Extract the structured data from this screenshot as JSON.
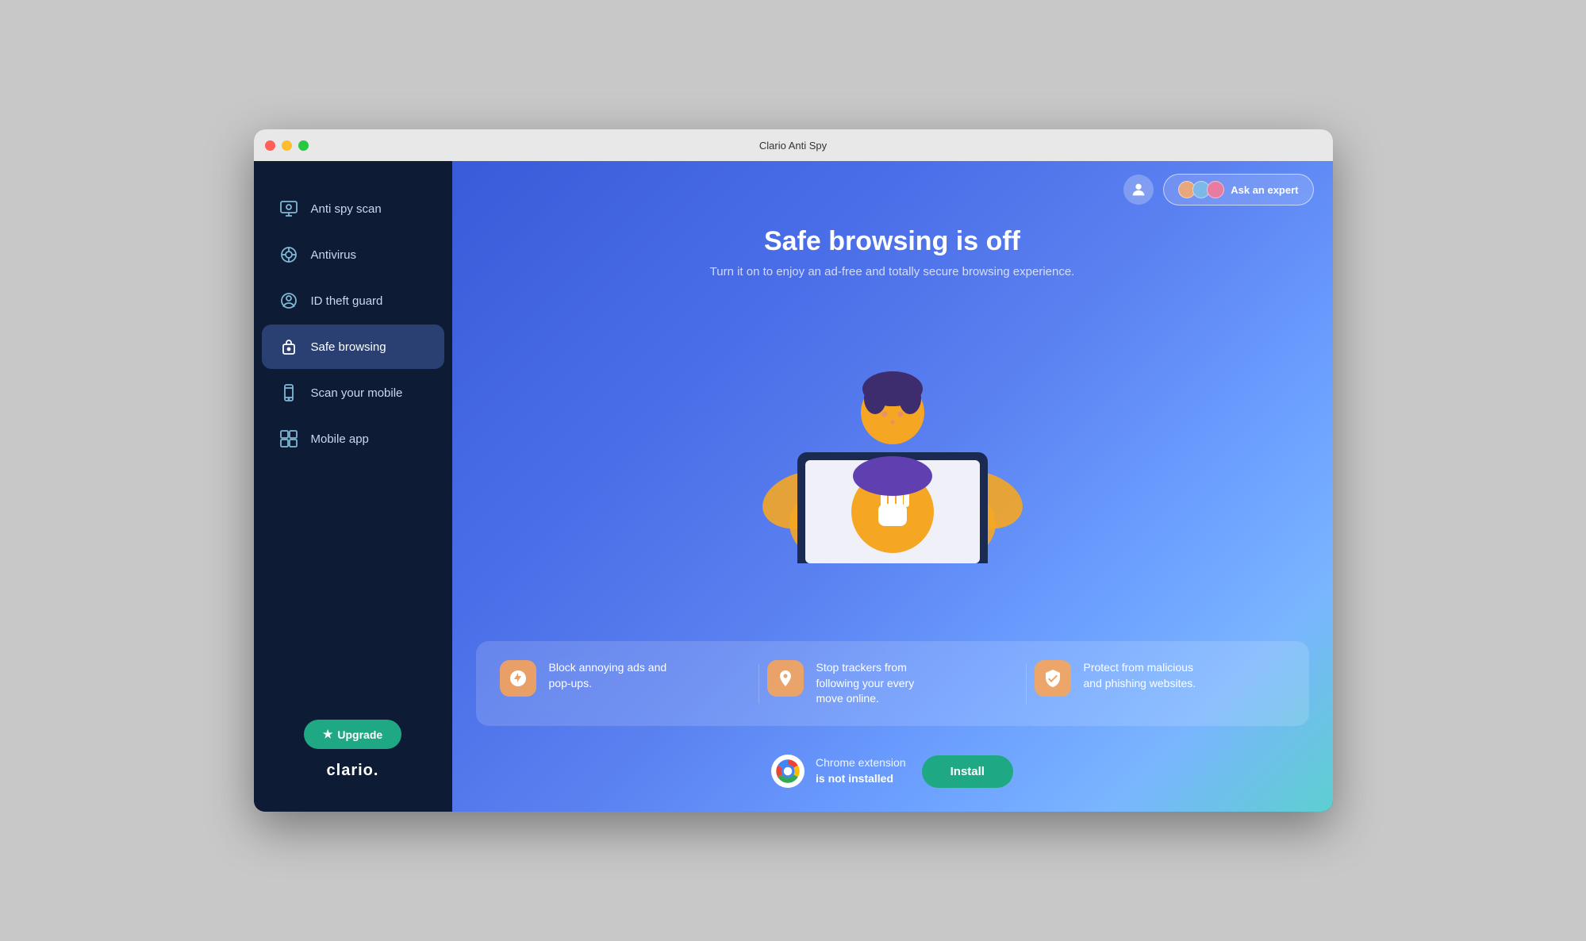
{
  "window": {
    "title": "Clario Anti Spy"
  },
  "sidebar": {
    "items": [
      {
        "id": "anti-spy-scan",
        "label": "Anti spy scan",
        "active": false
      },
      {
        "id": "antivirus",
        "label": "Antivirus",
        "active": false
      },
      {
        "id": "id-theft-guard",
        "label": "ID theft guard",
        "active": false
      },
      {
        "id": "safe-browsing",
        "label": "Safe browsing",
        "active": true
      },
      {
        "id": "scan-your-mobile",
        "label": "Scan your mobile",
        "active": false
      },
      {
        "id": "mobile-app",
        "label": "Mobile app",
        "active": false
      }
    ],
    "upgrade_label": "Upgrade",
    "logo": "clario."
  },
  "header": {
    "ask_expert_label": "Ask an expert"
  },
  "hero": {
    "title": "Safe browsing is off",
    "subtitle": "Turn it on to enjoy an ad-free and totally secure browsing experience."
  },
  "features": [
    {
      "id": "block-ads",
      "text": "Block annoying ads and pop-ups."
    },
    {
      "id": "stop-trackers",
      "text": "Stop trackers from following your every move online."
    },
    {
      "id": "protect-malicious",
      "text": "Protect from malicious and phishing websites."
    }
  ],
  "chrome": {
    "status_line1": "Chrome extension",
    "status_line2": "is not installed",
    "install_label": "Install"
  }
}
